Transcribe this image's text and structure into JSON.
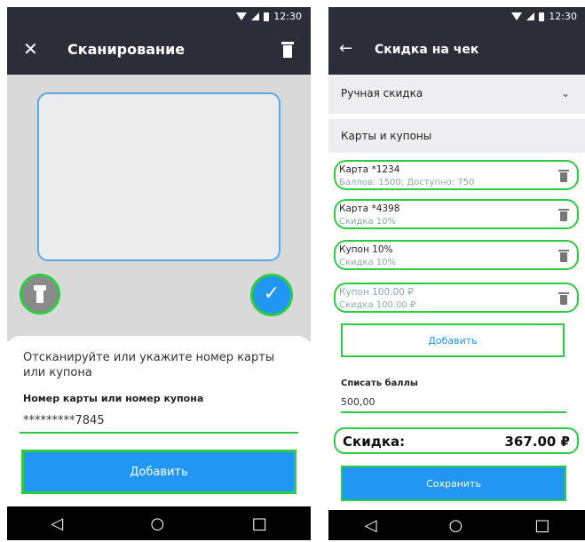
{
  "status": {
    "time": "12:30"
  },
  "screen1": {
    "title": "Сканирование",
    "close_icon": "close-icon",
    "delete_icon": "trash-icon",
    "hint": "Отсканируйте или укажите номер карты или купона",
    "field_label": "Номер карты или номер купона",
    "field_value": "*********7845",
    "add_label": "Добавить",
    "check_icon": "check-icon",
    "torch_icon": "flashlight-icon"
  },
  "screen2": {
    "title": "Скидка на чек",
    "manual_discount": "Ручная скидка",
    "cards_header": "Карты и купоны",
    "items": [
      {
        "name": "Карта *1234",
        "detail": "Баллов: 1500; Доступно: 750"
      },
      {
        "name": "Карта *4398",
        "detail": "Скидка 10%"
      },
      {
        "name": "Купон 10%",
        "detail": "Скидка 10%"
      },
      {
        "name": "Купон 100.00 ₽",
        "detail": "Скидка 100.00 ₽"
      }
    ],
    "add_label": "Добавить",
    "points_label": "Списать баллы",
    "points_value": "500,00",
    "discount_label": "Скидка:",
    "discount_value": "367.00 ₽",
    "save_label": "Сохранить"
  },
  "colors": {
    "accent": "#2196f3",
    "appbar": "#2d2d3a",
    "highlight": "#2ecc40"
  }
}
